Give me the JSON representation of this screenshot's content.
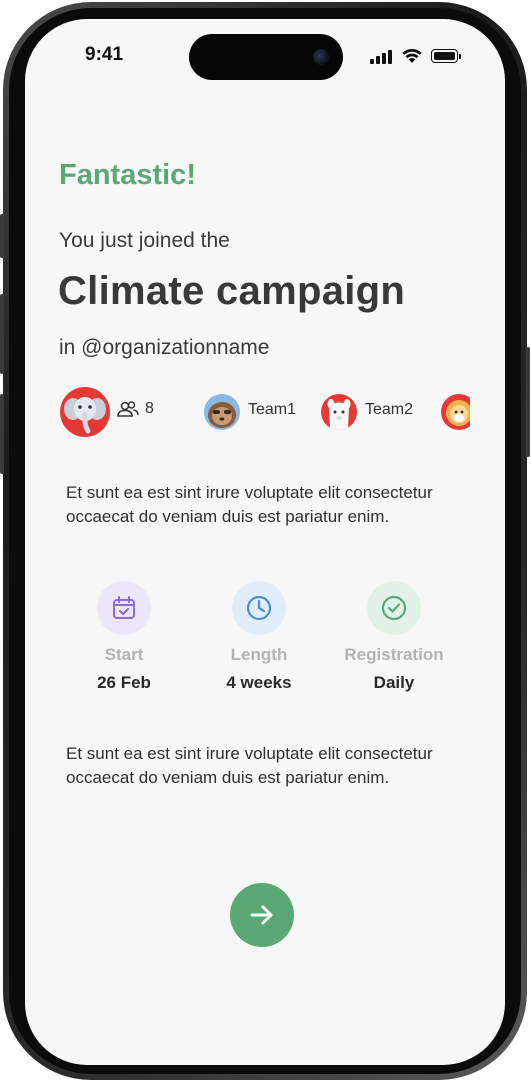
{
  "status_bar": {
    "time": "9:41"
  },
  "header": {
    "exclamation": "Fantastic!",
    "intro": "You just joined the",
    "campaign_name": "Climate campaign",
    "organization": "in @organizationname"
  },
  "teams": {
    "member_count": "8",
    "items": [
      {
        "label": "Team1",
        "icon": "sloth-avatar"
      },
      {
        "label": "Team2",
        "icon": "alpaca-avatar"
      },
      {
        "label": "",
        "icon": "lion-avatar"
      }
    ]
  },
  "description_top": "Et sunt ea est sint irure voluptate elit consectetur occaecat do veniam duis est pariatur enim.",
  "stats": [
    {
      "icon": "calendar-icon",
      "label": "Start",
      "value": "26 Feb",
      "color": "#8c6bd6",
      "bg": "#ece6fa"
    },
    {
      "icon": "clock-icon",
      "label": "Length",
      "value": "4 weeks",
      "color": "#4a8fd9",
      "bg": "#e2edfb"
    },
    {
      "icon": "check-circle-icon",
      "label": "Registration",
      "value": "Daily",
      "color": "#5aa874",
      "bg": "#e3f2e7"
    }
  ],
  "description_bottom": "Et sunt ea est sint irure voluptate elit consectetur occaecat do veniam duis est pariatur enim.",
  "colors": {
    "accent": "#5aa874",
    "text": "#393939"
  }
}
